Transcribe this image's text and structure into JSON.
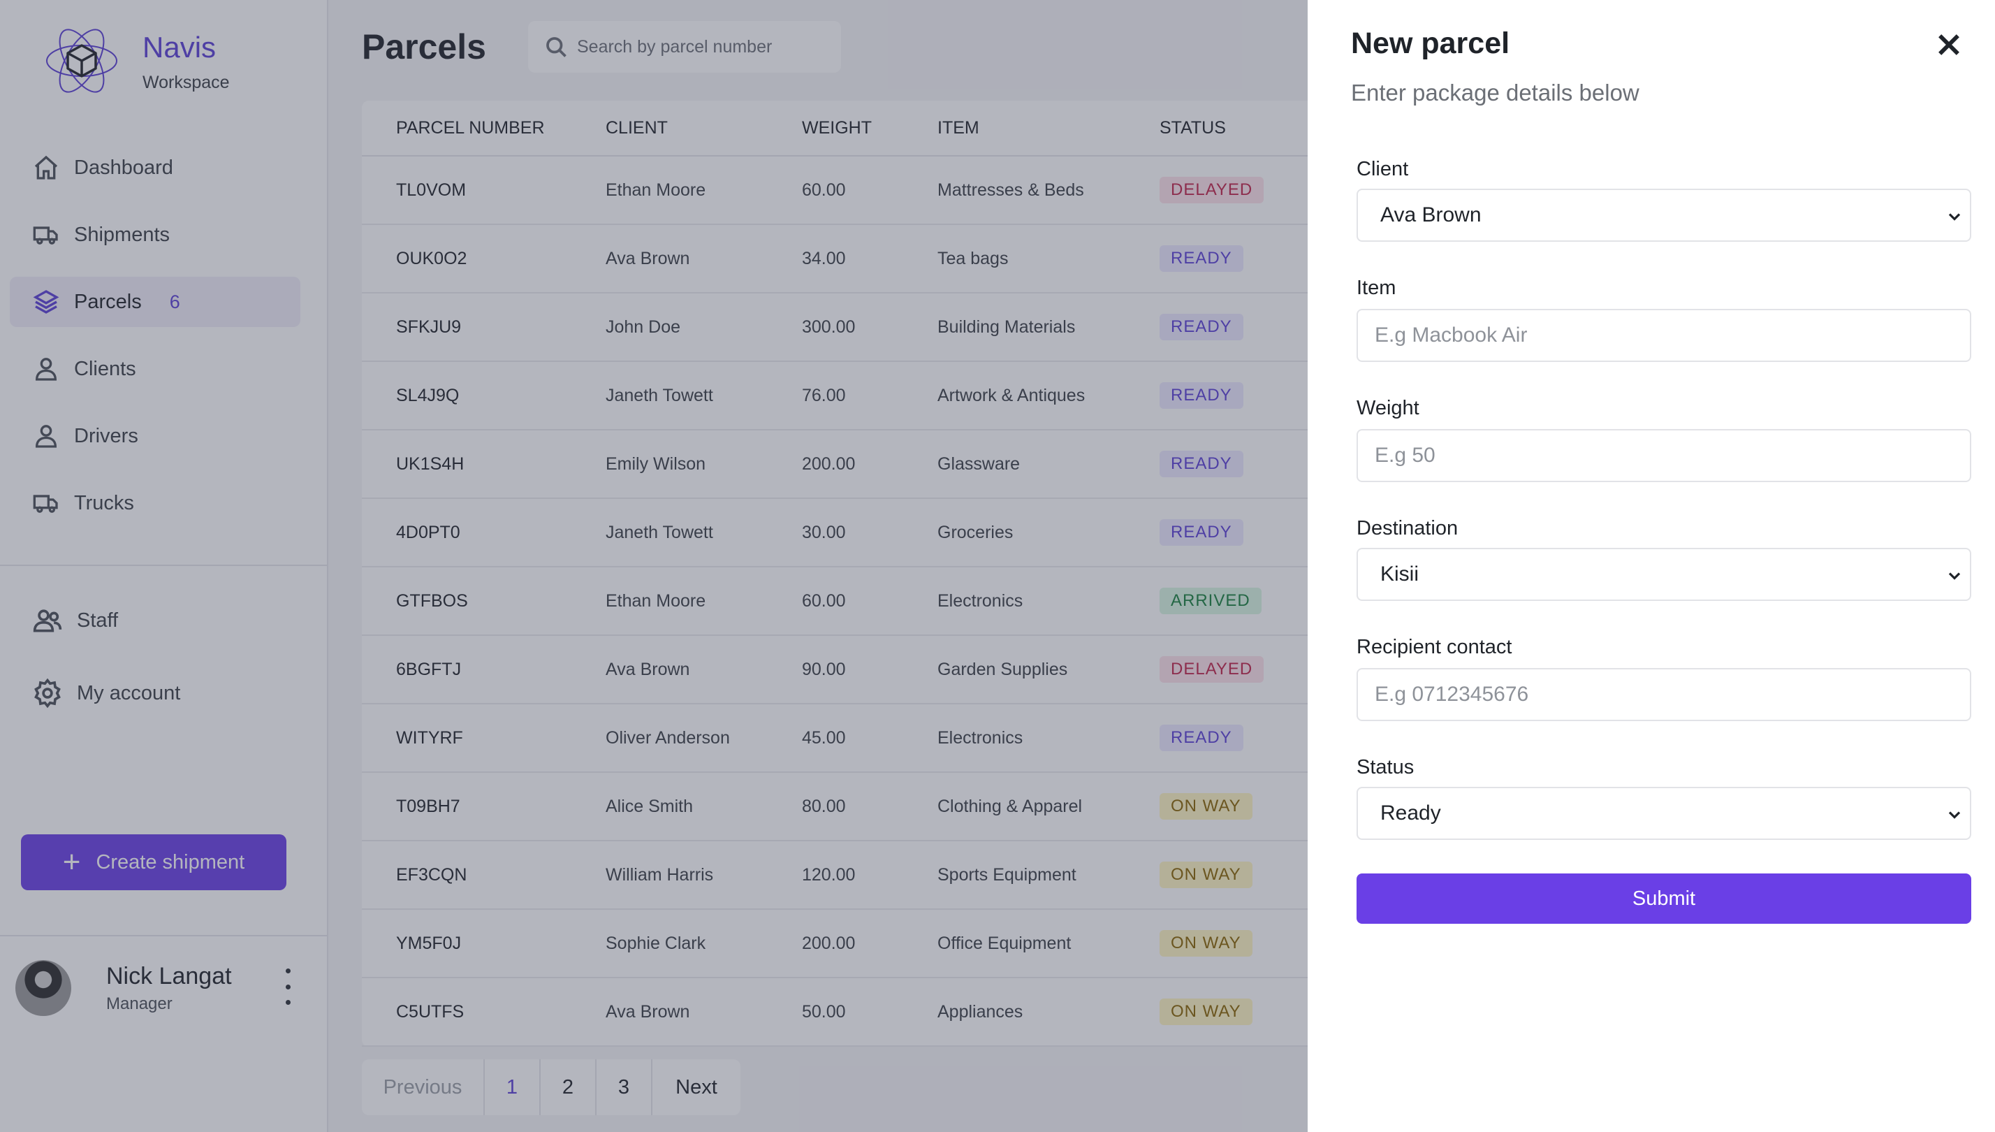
{
  "brand": {
    "name": "Navis",
    "subtitle": "Workspace"
  },
  "nav": {
    "items": [
      {
        "label": "Dashboard",
        "icon": "home-icon"
      },
      {
        "label": "Shipments",
        "icon": "truck-icon"
      },
      {
        "label": "Parcels",
        "icon": "layers-icon",
        "badge": "6",
        "active": true
      },
      {
        "label": "Clients",
        "icon": "user-icon"
      },
      {
        "label": "Drivers",
        "icon": "user-icon"
      },
      {
        "label": "Trucks",
        "icon": "truck-icon"
      }
    ],
    "secondary": [
      {
        "label": "Staff",
        "icon": "users-icon"
      },
      {
        "label": "My account",
        "icon": "gear-icon"
      }
    ],
    "create_label": "Create shipment"
  },
  "user": {
    "name": "Nick Langat",
    "role": "Manager"
  },
  "page": {
    "title": "Parcels",
    "search_placeholder": "Search by parcel number"
  },
  "table": {
    "headers": [
      "PARCEL NUMBER",
      "CLIENT",
      "WEIGHT",
      "ITEM",
      "STATUS"
    ],
    "rows": [
      {
        "number": "TL0VOM",
        "client": "Ethan Moore",
        "weight": "60.00",
        "item": "Mattresses & Beds",
        "status": "DELAYED"
      },
      {
        "number": "OUK0O2",
        "client": "Ava Brown",
        "weight": "34.00",
        "item": "Tea bags",
        "status": "READY"
      },
      {
        "number": "SFKJU9",
        "client": "John Doe",
        "weight": "300.00",
        "item": "Building Materials",
        "status": "READY"
      },
      {
        "number": "SL4J9Q",
        "client": "Janeth Towett",
        "weight": "76.00",
        "item": "Artwork & Antiques",
        "status": "READY"
      },
      {
        "number": "UK1S4H",
        "client": "Emily Wilson",
        "weight": "200.00",
        "item": "Glassware",
        "status": "READY"
      },
      {
        "number": "4D0PT0",
        "client": "Janeth Towett",
        "weight": "30.00",
        "item": "Groceries",
        "status": "READY"
      },
      {
        "number": "GTFBOS",
        "client": "Ethan Moore",
        "weight": "60.00",
        "item": "Electronics",
        "status": "ARRIVED"
      },
      {
        "number": "6BGFTJ",
        "client": "Ava Brown",
        "weight": "90.00",
        "item": "Garden Supplies",
        "status": "DELAYED"
      },
      {
        "number": "WITYRF",
        "client": "Oliver Anderson",
        "weight": "45.00",
        "item": "Electronics",
        "status": "READY"
      },
      {
        "number": "T09BH7",
        "client": "Alice Smith",
        "weight": "80.00",
        "item": "Clothing & Apparel",
        "status": "ON WAY"
      },
      {
        "number": "EF3CQN",
        "client": "William Harris",
        "weight": "120.00",
        "item": "Sports Equipment",
        "status": "ON WAY"
      },
      {
        "number": "YM5F0J",
        "client": "Sophie Clark",
        "weight": "200.00",
        "item": "Office Equipment",
        "status": "ON WAY"
      },
      {
        "number": "C5UTFS",
        "client": "Ava Brown",
        "weight": "50.00",
        "item": "Appliances",
        "status": "ON WAY"
      }
    ]
  },
  "pagination": {
    "previous": "Previous",
    "pages": [
      "1",
      "2",
      "3"
    ],
    "current": "1",
    "next": "Next"
  },
  "drawer": {
    "title": "New parcel",
    "subtitle": "Enter package details below",
    "client": {
      "label": "Client",
      "value": "Ava Brown"
    },
    "item": {
      "label": "Item",
      "placeholder": "E.g Macbook Air"
    },
    "weight": {
      "label": "Weight",
      "placeholder": "E.g 50"
    },
    "destination": {
      "label": "Destination",
      "value": "Kisii"
    },
    "recipient": {
      "label": "Recipient contact",
      "placeholder": "E.g 0712345676"
    },
    "status": {
      "label": "Status",
      "value": "Ready"
    },
    "submit_label": "Submit"
  },
  "colors": {
    "accent": "#6a3fe6",
    "status_delayed": "#c0234a",
    "status_ready": "#5b3fd6",
    "status_arrived": "#17803d",
    "status_onway": "#8a6500"
  }
}
